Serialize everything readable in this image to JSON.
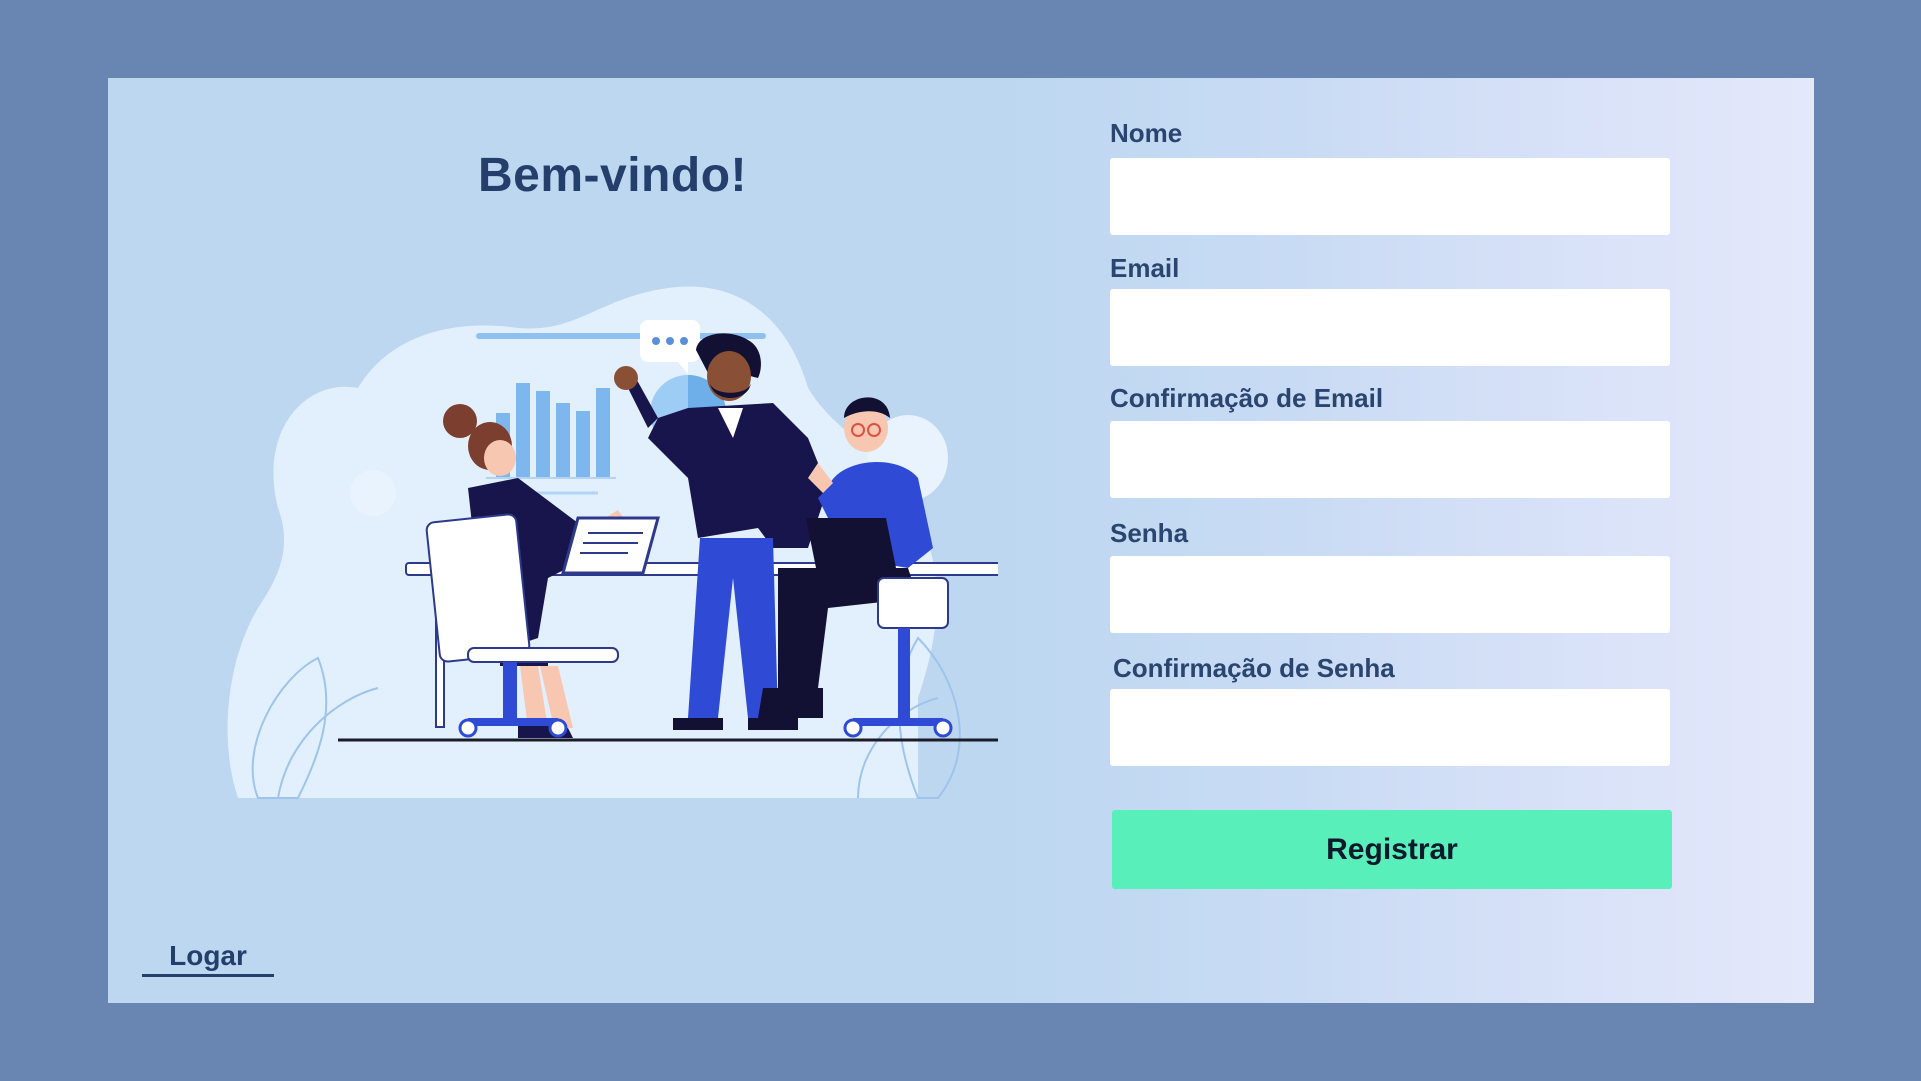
{
  "welcome": {
    "title": "Bem-vindo!"
  },
  "form": {
    "fields": [
      {
        "label": "Nome",
        "value": "",
        "type": "text"
      },
      {
        "label": "Email",
        "value": "",
        "type": "email"
      },
      {
        "label": "Confirmação de Email",
        "value": "",
        "type": "email"
      },
      {
        "label": "Senha",
        "value": "",
        "type": "password"
      },
      {
        "label": "Confirmação de Senha",
        "value": "",
        "type": "password"
      }
    ],
    "submit_label": "Registrar"
  },
  "footer": {
    "login_label": "Logar"
  },
  "colors": {
    "page_background": "#6886b1",
    "panel_background": "#bdd7f1",
    "heading_text": "#243f6b",
    "submit_button": "#58efbb"
  },
  "illustration": {
    "icons": [
      "team-meeting-illustration",
      "speech-bubble-icon",
      "bar-chart-icon",
      "pie-chart-icon",
      "laptop-icon",
      "office-chair-icon"
    ]
  }
}
